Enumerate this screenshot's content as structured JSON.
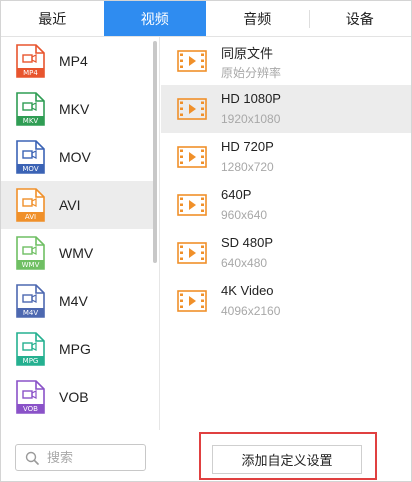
{
  "tabs": [
    {
      "label": "最近"
    },
    {
      "label": "视频"
    },
    {
      "label": "音频"
    },
    {
      "label": "设备"
    }
  ],
  "active_tab": "视频",
  "formats": [
    {
      "label": "MP4",
      "color": "#e8552e"
    },
    {
      "label": "MKV",
      "color": "#2f9d54"
    },
    {
      "label": "MOV",
      "color": "#3b63b5"
    },
    {
      "label": "AVI",
      "color": "#f0902a"
    },
    {
      "label": "WMV",
      "color": "#6fbf63"
    },
    {
      "label": "M4V",
      "color": "#4d68b0"
    },
    {
      "label": "MPG",
      "color": "#25b090"
    },
    {
      "label": "VOB",
      "color": "#8a52c8"
    }
  ],
  "selected_format": "AVI",
  "presets": [
    {
      "name": "同原文件",
      "resolution": "原始分辨率"
    },
    {
      "name": "HD 1080P",
      "resolution": "1920x1080"
    },
    {
      "name": "HD 720P",
      "resolution": "1280x720"
    },
    {
      "name": "640P",
      "resolution": "960x640"
    },
    {
      "name": "SD 480P",
      "resolution": "640x480"
    },
    {
      "name": "4K Video",
      "resolution": "4096x2160"
    }
  ],
  "selected_preset": "HD 1080P",
  "search": {
    "placeholder": "搜索"
  },
  "custom_button_label": "添加自定义设置",
  "colors": {
    "accent": "#2f8cf0",
    "preset_icon": "#f0902a",
    "highlight": "#e04040"
  }
}
